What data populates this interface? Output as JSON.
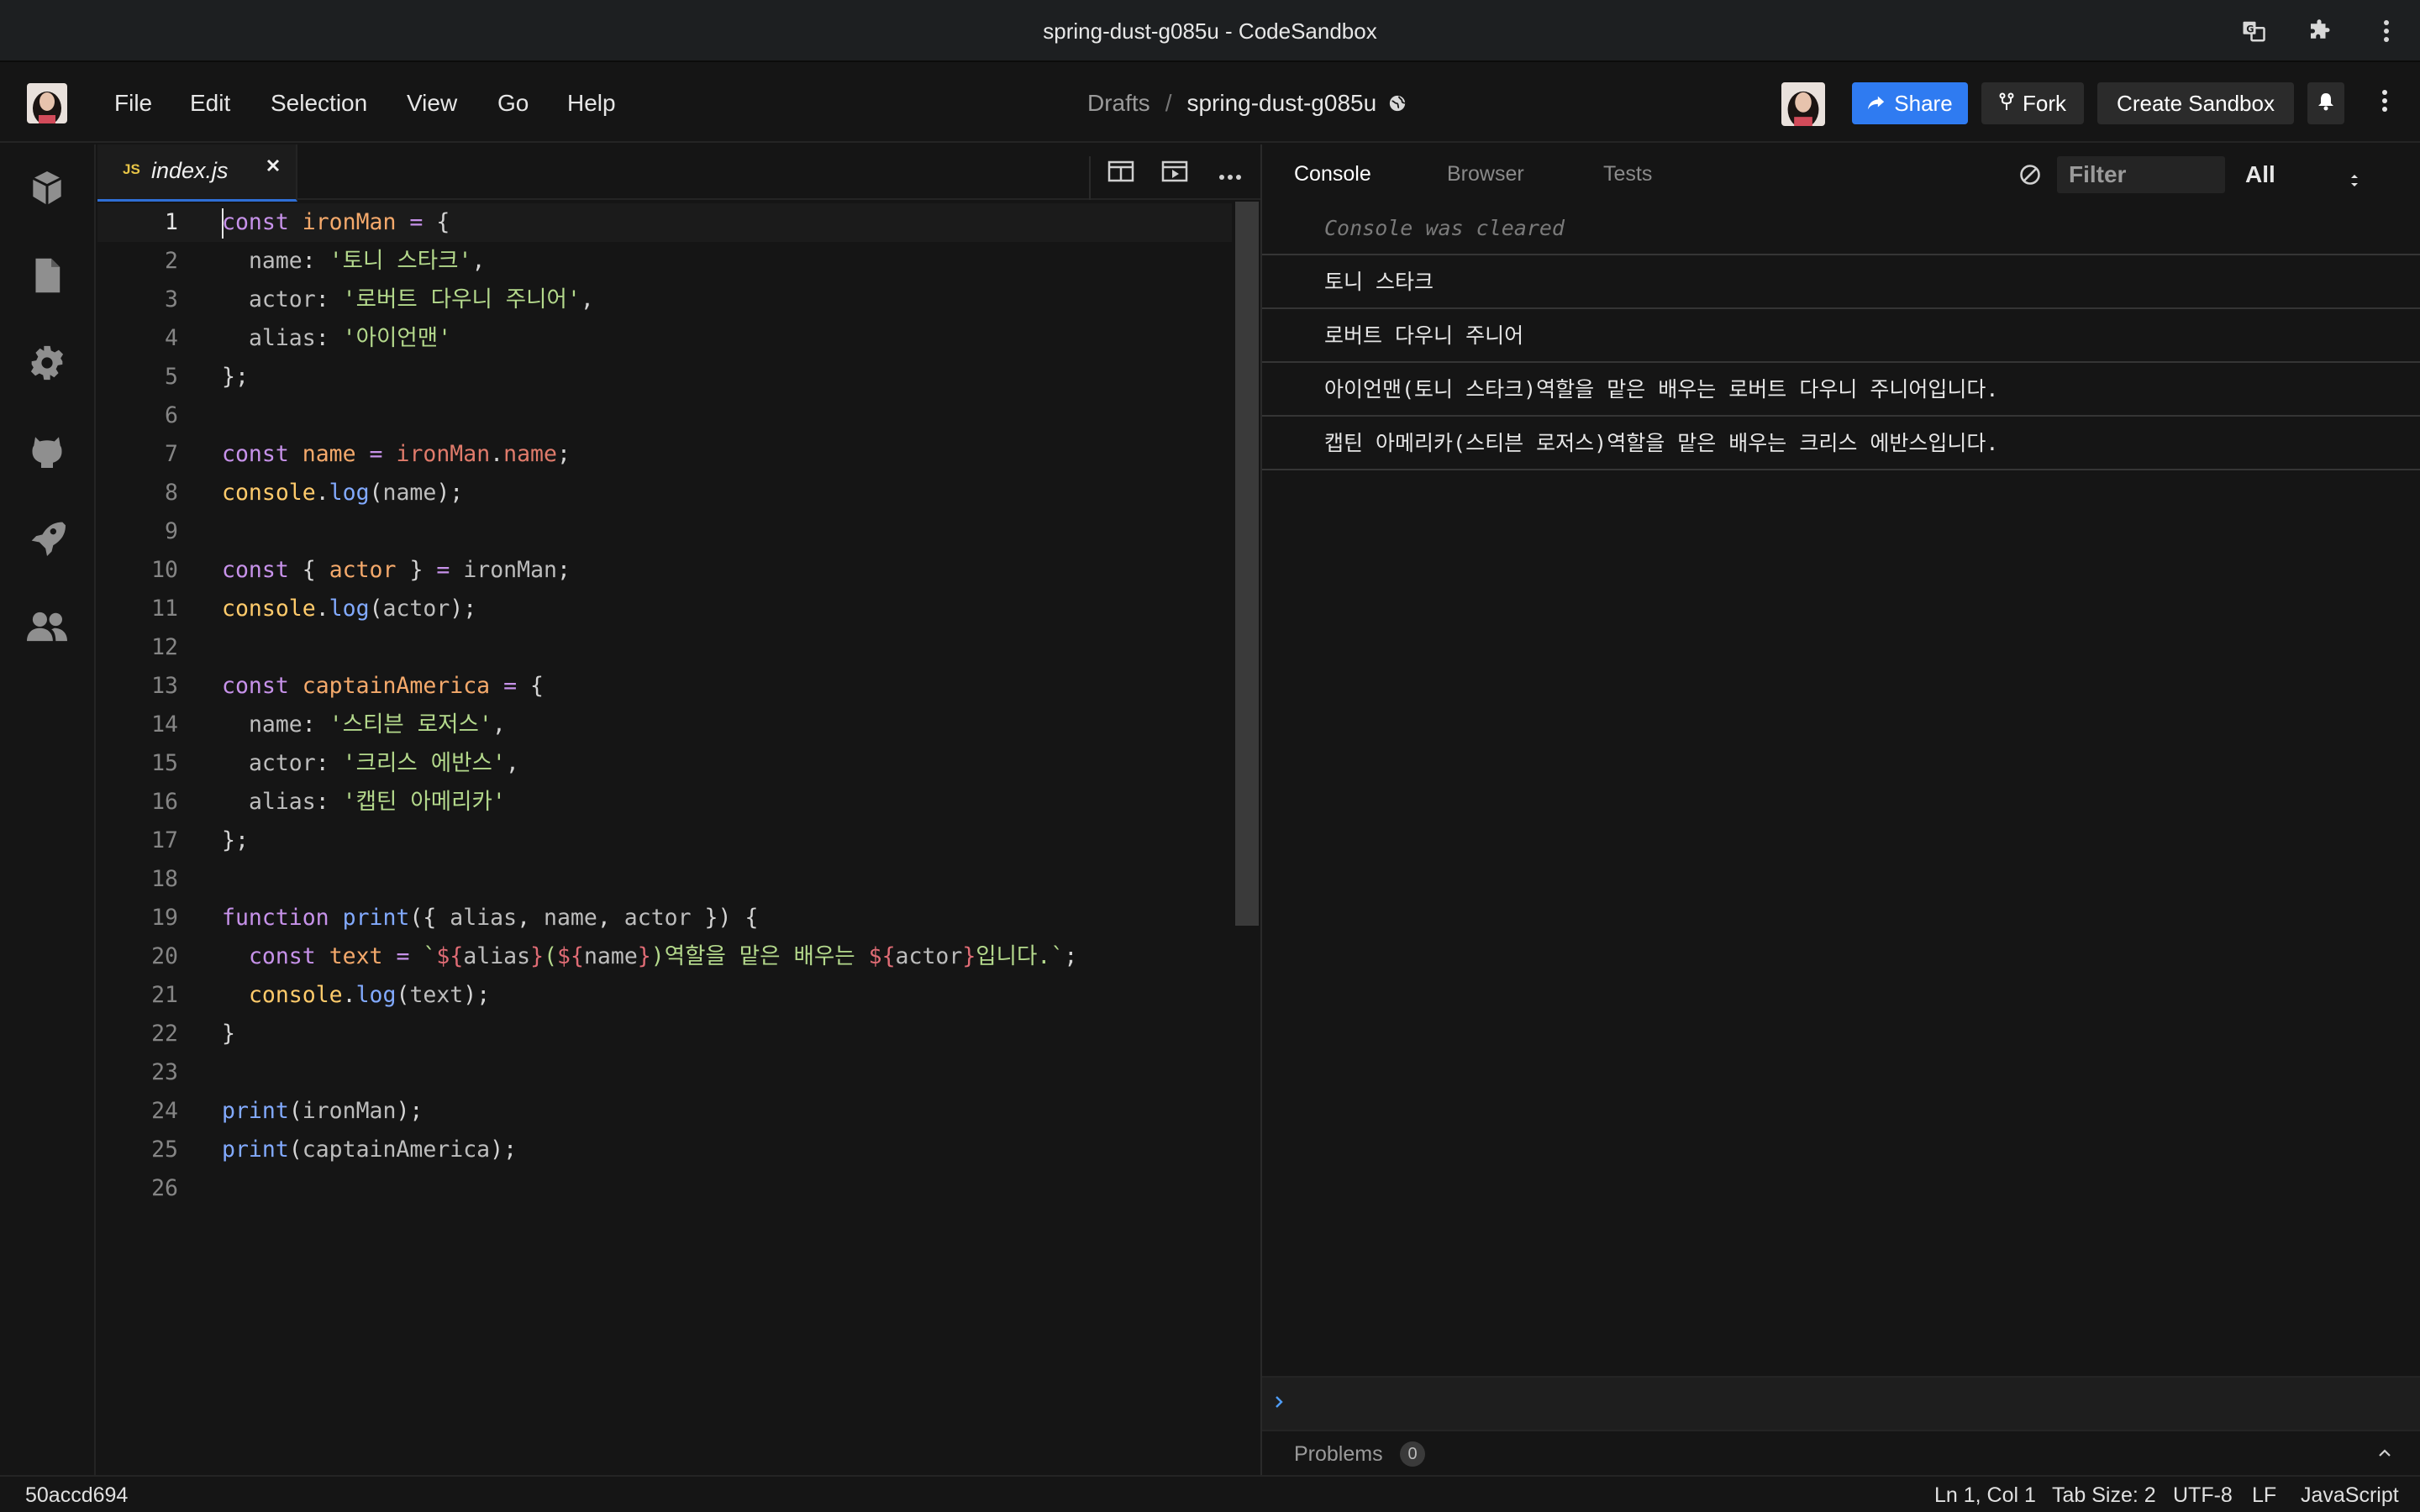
{
  "window": {
    "title": "spring-dust-g085u - CodeSandbox"
  },
  "menu": [
    "File",
    "Edit",
    "Selection",
    "View",
    "Go",
    "Help"
  ],
  "breadcrumb": {
    "folder": "Drafts",
    "separator": "/",
    "name": "spring-dust-g085u"
  },
  "header_buttons": {
    "share": "Share",
    "fork": "Fork",
    "create": "Create Sandbox"
  },
  "colors": {
    "accent": "#2f7bf1",
    "background": "#151515",
    "button_dark": "#2b2b2b"
  },
  "editor": {
    "tab": {
      "badge": "JS",
      "label": "index.js"
    },
    "lines": [
      {
        "n": "1",
        "code": "const ironMan = {"
      },
      {
        "n": "2",
        "code": "  name: '토니 스타크',"
      },
      {
        "n": "3",
        "code": "  actor: '로버트 다우니 주니어',"
      },
      {
        "n": "4",
        "code": "  alias: '아이언맨'"
      },
      {
        "n": "5",
        "code": "};"
      },
      {
        "n": "6",
        "code": ""
      },
      {
        "n": "7",
        "code": "const name = ironMan.name;"
      },
      {
        "n": "8",
        "code": "console.log(name);"
      },
      {
        "n": "9",
        "code": ""
      },
      {
        "n": "10",
        "code": "const { actor } = ironMan;"
      },
      {
        "n": "11",
        "code": "console.log(actor);"
      },
      {
        "n": "12",
        "code": ""
      },
      {
        "n": "13",
        "code": "const captainAmerica = {"
      },
      {
        "n": "14",
        "code": "  name: '스티븐 로저스',"
      },
      {
        "n": "15",
        "code": "  actor: '크리스 에반스',"
      },
      {
        "n": "16",
        "code": "  alias: '캡틴 아메리카'"
      },
      {
        "n": "17",
        "code": "};"
      },
      {
        "n": "18",
        "code": ""
      },
      {
        "n": "19",
        "code": "function print({ alias, name, actor }) {"
      },
      {
        "n": "20",
        "code": "  const text = `${alias}(${name})역할을 맡은 배우는 ${actor}입니다.`;"
      },
      {
        "n": "21",
        "code": "  console.log(text);"
      },
      {
        "n": "22",
        "code": "}"
      },
      {
        "n": "23",
        "code": ""
      },
      {
        "n": "24",
        "code": "print(ironMan);"
      },
      {
        "n": "25",
        "code": "print(captainAmerica);"
      },
      {
        "n": "26",
        "code": ""
      }
    ]
  },
  "panel": {
    "tabs": [
      "Console",
      "Browser",
      "Tests"
    ],
    "filter_placeholder": "Filter",
    "level": "All",
    "cleared": "Console was cleared",
    "logs": [
      "토니 스타크",
      "로버트 다우니 주니어",
      "아이언맨(토니 스타크)역할을 맡은 배우는 로버트 다우니 주니어입니다.",
      "캡틴 아메리카(스티븐 로저스)역할을 맡은 배우는 크리스 에반스입니다."
    ],
    "problems_label": "Problems",
    "problems_count": "0"
  },
  "status": {
    "commit": "50accd694",
    "position": "Ln 1, Col 1",
    "tab_size": "Tab Size: 2",
    "encoding": "UTF-8",
    "eol": "LF",
    "language": "JavaScript"
  }
}
